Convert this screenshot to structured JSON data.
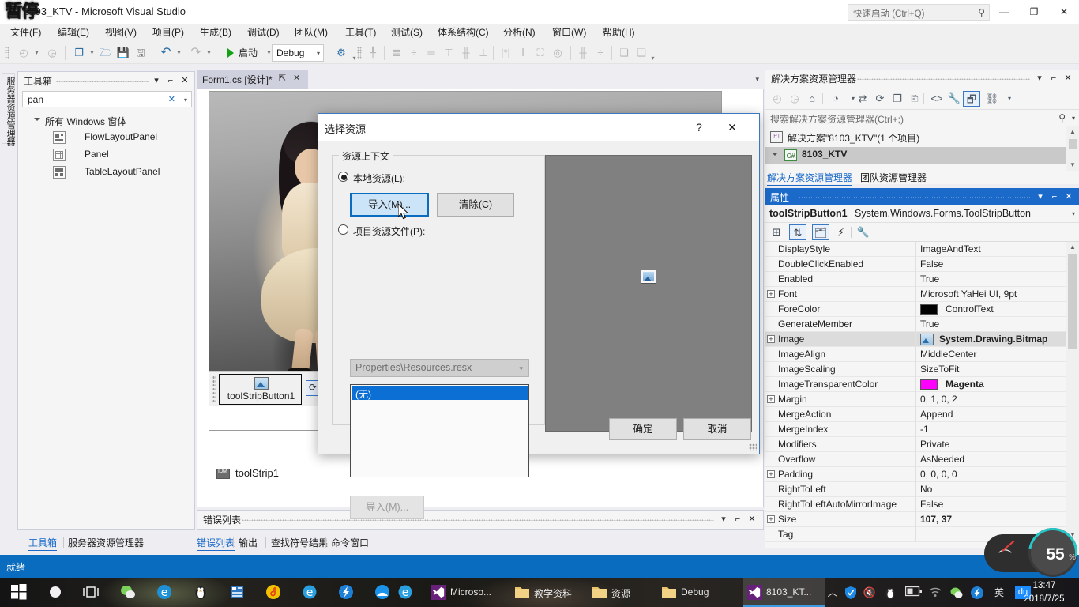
{
  "titlebar": {
    "app_title": "8103_KTV - Microsoft Visual Studio",
    "overlay_text": "暂停",
    "quick_launch_placeholder": "快速启动 (Ctrl+Q)",
    "search_icon": "search-icon",
    "minimize": "—",
    "maximize": "❐",
    "close": "✕"
  },
  "menu": [
    {
      "label": "文件(F)"
    },
    {
      "label": "编辑(E)"
    },
    {
      "label": "视图(V)"
    },
    {
      "label": "项目(P)"
    },
    {
      "label": "生成(B)"
    },
    {
      "label": "调试(D)"
    },
    {
      "label": "团队(M)"
    },
    {
      "label": "工具(T)"
    },
    {
      "label": "测试(S)"
    },
    {
      "label": "体系结构(C)"
    },
    {
      "label": "分析(N)"
    },
    {
      "label": "窗口(W)"
    },
    {
      "label": "帮助(H)"
    }
  ],
  "toolbar": {
    "run_label": "启动",
    "config_value": "Debug",
    "config_arrow": "▾"
  },
  "left_vertical_tab": {
    "label": "服务器资源管理器"
  },
  "toolbox": {
    "title": "工具箱",
    "close": "✕",
    "pin": "⌐",
    "chevron": "▾",
    "search_value": "pan",
    "search_clear": "✕",
    "search_arrow": "▾",
    "group_label": "所有 Windows 窗体",
    "items": [
      {
        "label": "FlowLayoutPanel",
        "icon": "flowlayoutpanel-icon"
      },
      {
        "label": "Panel",
        "icon": "panel-icon"
      },
      {
        "label": "TableLayoutPanel",
        "icon": "tablelayoutpanel-icon"
      }
    ]
  },
  "document_tab": {
    "label": "Form1.cs [设计]*",
    "pin": "⇱",
    "close": "✕",
    "strip_dropdown": "▾"
  },
  "designer": {
    "toolstrip_button_label": "toolStripButton1",
    "toolstrip_label": "toolStrip1"
  },
  "error_panel": {
    "title": "错误列表",
    "chevron": "▾",
    "pin": "⌐",
    "close": "✕"
  },
  "bottom_dock_tabs": [
    {
      "label": "工具箱",
      "active": true
    },
    {
      "label": "服务器资源管理器",
      "active": false
    },
    {
      "label": "错误列表",
      "active": true
    },
    {
      "label": "输出",
      "active": false
    },
    {
      "label": "查找符号结果",
      "active": false
    },
    {
      "label": "命令窗口",
      "active": false
    }
  ],
  "solution_explorer": {
    "title": "解决方案资源管理器",
    "chevron": "▾",
    "pin": "⌐",
    "close": "✕",
    "search_placeholder": "搜索解决方案资源管理器(Ctrl+;)",
    "search_icon": "search-icon",
    "search_arrow": "▾",
    "solution_row": "解决方案\"8103_KTV\"(1 个项目)",
    "project_row": "8103_KTV",
    "project_badge": "C#",
    "tabs": [
      {
        "label": "解决方案资源管理器",
        "active": true
      },
      {
        "label": "团队资源管理器",
        "active": false
      }
    ]
  },
  "properties": {
    "title": "属性",
    "chevron": "▾",
    "pin": "⌐",
    "close": "✕",
    "object_name": "toolStripButton1",
    "object_type": "System.Windows.Forms.ToolStripButton",
    "object_arrow": "▾",
    "toolbar_icons": [
      "categorized-icon",
      "alphabetical-sort-icon",
      "properties-icon",
      "events-icon",
      "property-pages-icon"
    ],
    "rows": [
      {
        "key": "DisplayStyle",
        "value": "ImageAndText",
        "expand": false,
        "bold": false
      },
      {
        "key": "DoubleClickEnabled",
        "value": "False",
        "expand": false,
        "bold": false
      },
      {
        "key": "Enabled",
        "value": "True",
        "expand": false,
        "bold": false
      },
      {
        "key": "Font",
        "value": "Microsoft YaHei UI, 9pt",
        "expand": true,
        "bold": false
      },
      {
        "key": "ForeColor",
        "value": "ControlText",
        "expand": false,
        "bold": false,
        "swatch": "#000000"
      },
      {
        "key": "GenerateMember",
        "value": "True",
        "expand": false,
        "bold": false
      },
      {
        "key": "Image",
        "value": "System.Drawing.Bitmap",
        "expand": true,
        "bold": true,
        "highlight": true,
        "image_icon": true
      },
      {
        "key": "ImageAlign",
        "value": "MiddleCenter",
        "expand": false,
        "bold": false
      },
      {
        "key": "ImageScaling",
        "value": "SizeToFit",
        "expand": false,
        "bold": false
      },
      {
        "key": "ImageTransparentColor",
        "value": "Magenta",
        "expand": false,
        "bold": true,
        "swatch": "#FF00FF"
      },
      {
        "key": "Margin",
        "value": "0, 1, 0, 2",
        "expand": true,
        "bold": false
      },
      {
        "key": "MergeAction",
        "value": "Append",
        "expand": false,
        "bold": false
      },
      {
        "key": "MergeIndex",
        "value": "-1",
        "expand": false,
        "bold": false
      },
      {
        "key": "Modifiers",
        "value": "Private",
        "expand": false,
        "bold": false
      },
      {
        "key": "Overflow",
        "value": "AsNeeded",
        "expand": false,
        "bold": false
      },
      {
        "key": "Padding",
        "value": "0, 0, 0, 0",
        "expand": true,
        "bold": false
      },
      {
        "key": "RightToLeft",
        "value": "No",
        "expand": false,
        "bold": false
      },
      {
        "key": "RightToLeftAutoMirrorImage",
        "value": "False",
        "expand": false,
        "bold": false
      },
      {
        "key": "Size",
        "value": "107, 37",
        "expand": true,
        "bold": true
      },
      {
        "key": "Tag",
        "value": "",
        "expand": false,
        "bold": false
      }
    ]
  },
  "dialog": {
    "title": "选择资源",
    "help_icon": "?",
    "close_icon": "✕",
    "group_legend": "资源上下文",
    "radio_local_label": "本地资源(L):",
    "radio_project_label": "项目资源文件(P):",
    "import_button": "导入(M)...",
    "clear_button": "清除(C)",
    "resx_combo_value": "Properties\\Resources.resx",
    "resx_combo_arrow": "▾",
    "list_selected_item": "(无)",
    "import_button_disabled": "导入(M)...",
    "ok_button": "确定",
    "cancel_button": "取消",
    "preview_icon": "image-placeholder-icon"
  },
  "statusbar": {
    "text": "就绪"
  },
  "taskbar": {
    "start_icon": "windows-start-icon",
    "pinned_icons": [
      "cortana-icon",
      "task-view-icon",
      "wechat-icon",
      "edge-icon",
      "qq-icon",
      "media-player-icon",
      "netease-music-icon",
      "ie-icon",
      "xunlei-icon",
      "qq-browser-icon",
      "ie2-icon"
    ],
    "buttons": [
      {
        "label": "Microso...",
        "icon": "visual-studio-icon",
        "active": false
      },
      {
        "label": "教学资料",
        "icon": "folder-icon",
        "active": false
      },
      {
        "label": "资源",
        "icon": "folder-icon",
        "active": false
      },
      {
        "label": "Debug",
        "icon": "folder-icon",
        "active": false
      },
      {
        "label": "8103_KT...",
        "icon": "visual-studio-icon",
        "active": true
      }
    ],
    "tray_icons": [
      "chevron-up-icon",
      "shield-icon",
      "volume-mute-icon",
      "qq-penguin-icon",
      "battery-icon",
      "wifi-icon",
      "wechat-icon",
      "xunlei-icon"
    ],
    "ime_label": "英",
    "ime_badge": "du",
    "time": "13:47",
    "date": "2018/7/25"
  },
  "recorder": {
    "value": "55",
    "unit": "%"
  }
}
